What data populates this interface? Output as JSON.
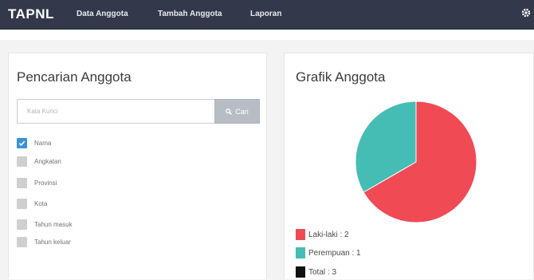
{
  "navbar": {
    "brand": "TAPNL",
    "links": [
      "Data Anggota",
      "Tambah Anggota",
      "Laporan"
    ]
  },
  "search_panel": {
    "title": "Pencarian Anggota",
    "input_placeholder": "Kata Kunci",
    "button_label": "Cari",
    "filters": [
      {
        "label": "Nama",
        "checked": true
      },
      {
        "label": "Angkatan",
        "checked": false
      },
      {
        "label": "Provinsi",
        "checked": false
      },
      {
        "label": "Kota",
        "checked": false
      },
      {
        "label": "Tahun masuk",
        "checked": false
      },
      {
        "label": "Tahun keluar",
        "checked": false
      }
    ]
  },
  "chart_panel": {
    "title": "Grafik Anggota",
    "legend": [
      {
        "text": "Laki-laki : 2",
        "color": "#f04a55"
      },
      {
        "text": "Perempuan : 1",
        "color": "#45bdb5"
      },
      {
        "text": "Total : 3",
        "color": "#111111"
      }
    ]
  },
  "chart_data": {
    "type": "pie",
    "title": "Grafik Anggota",
    "categories": [
      "Laki-laki",
      "Perempuan"
    ],
    "values": [
      2,
      1
    ],
    "total": 3,
    "colors": [
      "#f04a55",
      "#45bdb5"
    ],
    "legend_position": "bottom-left"
  },
  "colors": {
    "navbar": "#33384a",
    "accent_checkbox": "#3b92d6",
    "search_button": "#b6bec3"
  }
}
